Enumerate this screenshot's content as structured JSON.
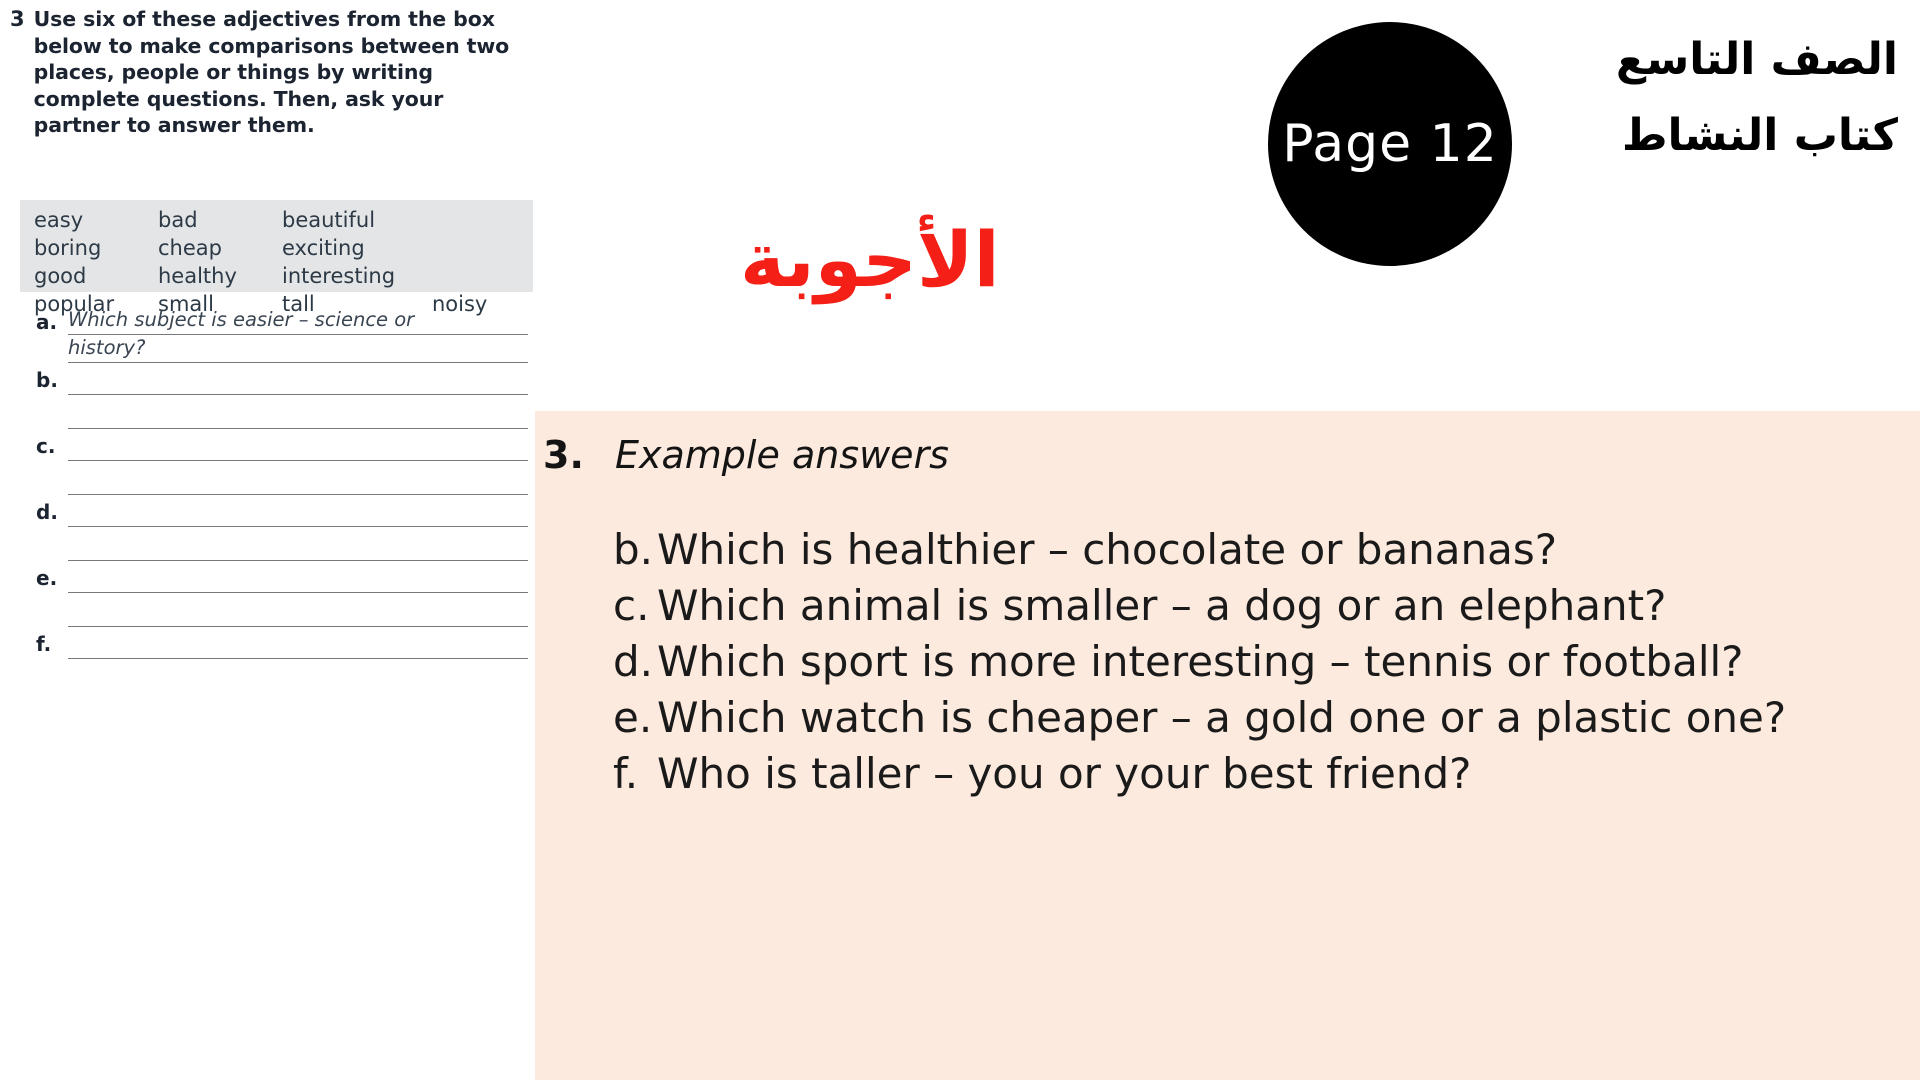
{
  "exercise": {
    "number": "3",
    "instructions": "Use six of these adjectives from the box below to make comparisons between two places, people or things by writing complete questions. Then, ask your partner to answer them.",
    "word_box": [
      [
        "easy",
        "bad",
        "beautiful",
        ""
      ],
      [
        "boring",
        "cheap",
        "exciting",
        ""
      ],
      [
        "good",
        "healthy",
        "interesting",
        ""
      ],
      [
        "popular",
        "small",
        "tall",
        "noisy"
      ]
    ],
    "items": [
      {
        "label": "a.",
        "written": "Which subject is easier – science or",
        "written2": "history?"
      },
      {
        "label": "b.",
        "written": "",
        "written2": ""
      },
      {
        "label": "c.",
        "written": "",
        "written2": ""
      },
      {
        "label": "d.",
        "written": "",
        "written2": ""
      },
      {
        "label": "e.",
        "written": "",
        "written2": ""
      },
      {
        "label": "f.",
        "written": "",
        "written2": ""
      }
    ]
  },
  "badge": {
    "page_label": "Page 12"
  },
  "headings": {
    "grade": "الصف التاسع",
    "book": "كتاب النشاط",
    "answers_title": "الأجوبة"
  },
  "answer_panel": {
    "number": "3.",
    "title": "Example answers",
    "items": [
      {
        "label": "b.",
        "text": "Which is healthier – chocolate or bananas?"
      },
      {
        "label": "c.",
        "text": "Which animal is smaller – a dog or an elephant?"
      },
      {
        "label": "d.",
        "text": "Which sport is more interesting – tennis or football?"
      },
      {
        "label": "e.",
        "text": "Which watch is cheaper – a gold one or a plastic one?"
      },
      {
        "label": "f.",
        "text": "Who is taller – you or your best friend?"
      }
    ]
  },
  "colors": {
    "panel_bg": "#fdeade",
    "accent_red": "#f41f16",
    "wordbox_bg": "#e3e5e7",
    "badge_bg": "#000000"
  }
}
